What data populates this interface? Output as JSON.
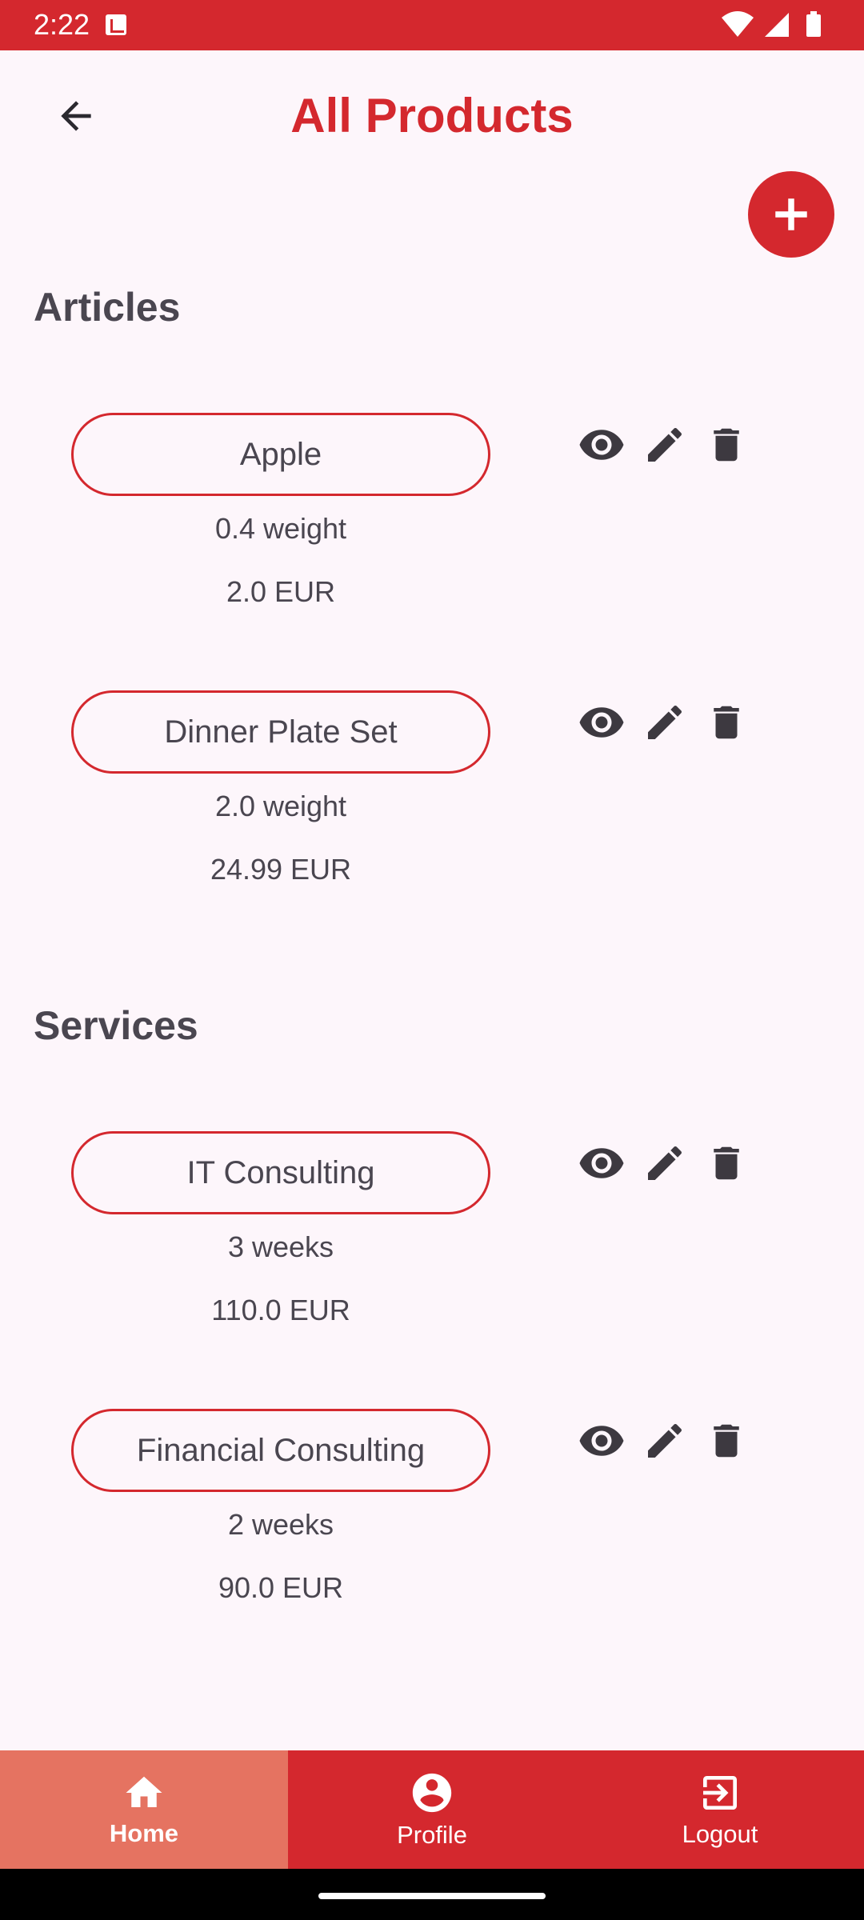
{
  "status_bar": {
    "time": "2:22",
    "icons": [
      "app-notification-icon",
      "wifi-icon",
      "signal-icon",
      "battery-icon"
    ]
  },
  "header": {
    "title": "All Products",
    "back_icon": "arrow-left-icon",
    "add_icon": "plus-icon"
  },
  "sections": {
    "articles": {
      "heading": "Articles",
      "items": [
        {
          "name": "Apple",
          "detail": "0.4 weight",
          "price": "2.0 EUR"
        },
        {
          "name": "Dinner Plate Set",
          "detail": "2.0 weight",
          "price": "24.99 EUR"
        }
      ]
    },
    "services": {
      "heading": "Services",
      "items": [
        {
          "name": "IT Consulting",
          "detail": "3 weeks",
          "price": "110.0 EUR"
        },
        {
          "name": "Financial Consulting",
          "detail": "2 weeks",
          "price": "90.0 EUR"
        }
      ]
    }
  },
  "actions": [
    "eye-icon",
    "pencil-icon",
    "trash-icon"
  ],
  "bottom_nav": {
    "items": [
      {
        "label": "Home",
        "icon": "home-icon",
        "active": true
      },
      {
        "label": "Profile",
        "icon": "profile-icon",
        "active": false
      },
      {
        "label": "Logout",
        "icon": "logout-icon",
        "active": false
      }
    ]
  },
  "colors": {
    "primary": "#d4282e",
    "active_nav": "#e57361",
    "background": "#fdf6fb",
    "text": "#4a4650"
  }
}
